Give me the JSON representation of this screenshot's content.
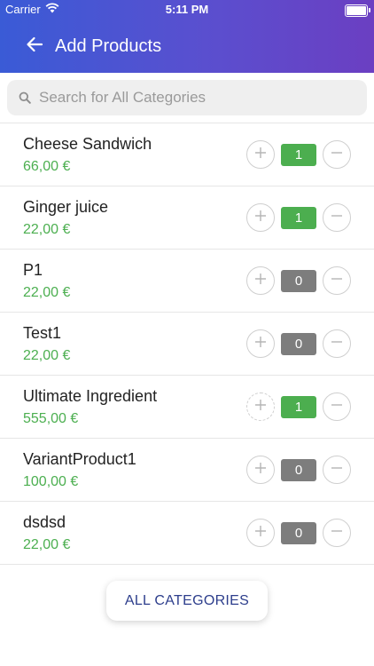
{
  "status_bar": {
    "carrier": "Carrier",
    "time": "5:11 PM"
  },
  "header": {
    "title": "Add Products"
  },
  "search": {
    "placeholder": "Search for All Categories"
  },
  "products": [
    {
      "name": "Cheese Sandwich",
      "price": "66,00 €",
      "qty": "1"
    },
    {
      "name": "Ginger juice",
      "price": "22,00 €",
      "qty": "1"
    },
    {
      "name": "P1",
      "price": "22,00 €",
      "qty": "0"
    },
    {
      "name": "Test1",
      "price": "22,00 €",
      "qty": "0"
    },
    {
      "name": "Ultimate Ingredient",
      "price": "555,00 €",
      "qty": "1"
    },
    {
      "name": "VariantProduct1",
      "price": "100,00 €",
      "qty": "0"
    },
    {
      "name": "dsdsd",
      "price": "22,00 €",
      "qty": "0"
    }
  ],
  "footer": {
    "all_categories_label": "ALL CATEGORIES"
  },
  "colors": {
    "header_start": "#3a5bd6",
    "header_end": "#6b3fc2",
    "price_green": "#4caf50",
    "qty_active": "#4cae4f",
    "qty_zero": "#7d7d7d"
  }
}
